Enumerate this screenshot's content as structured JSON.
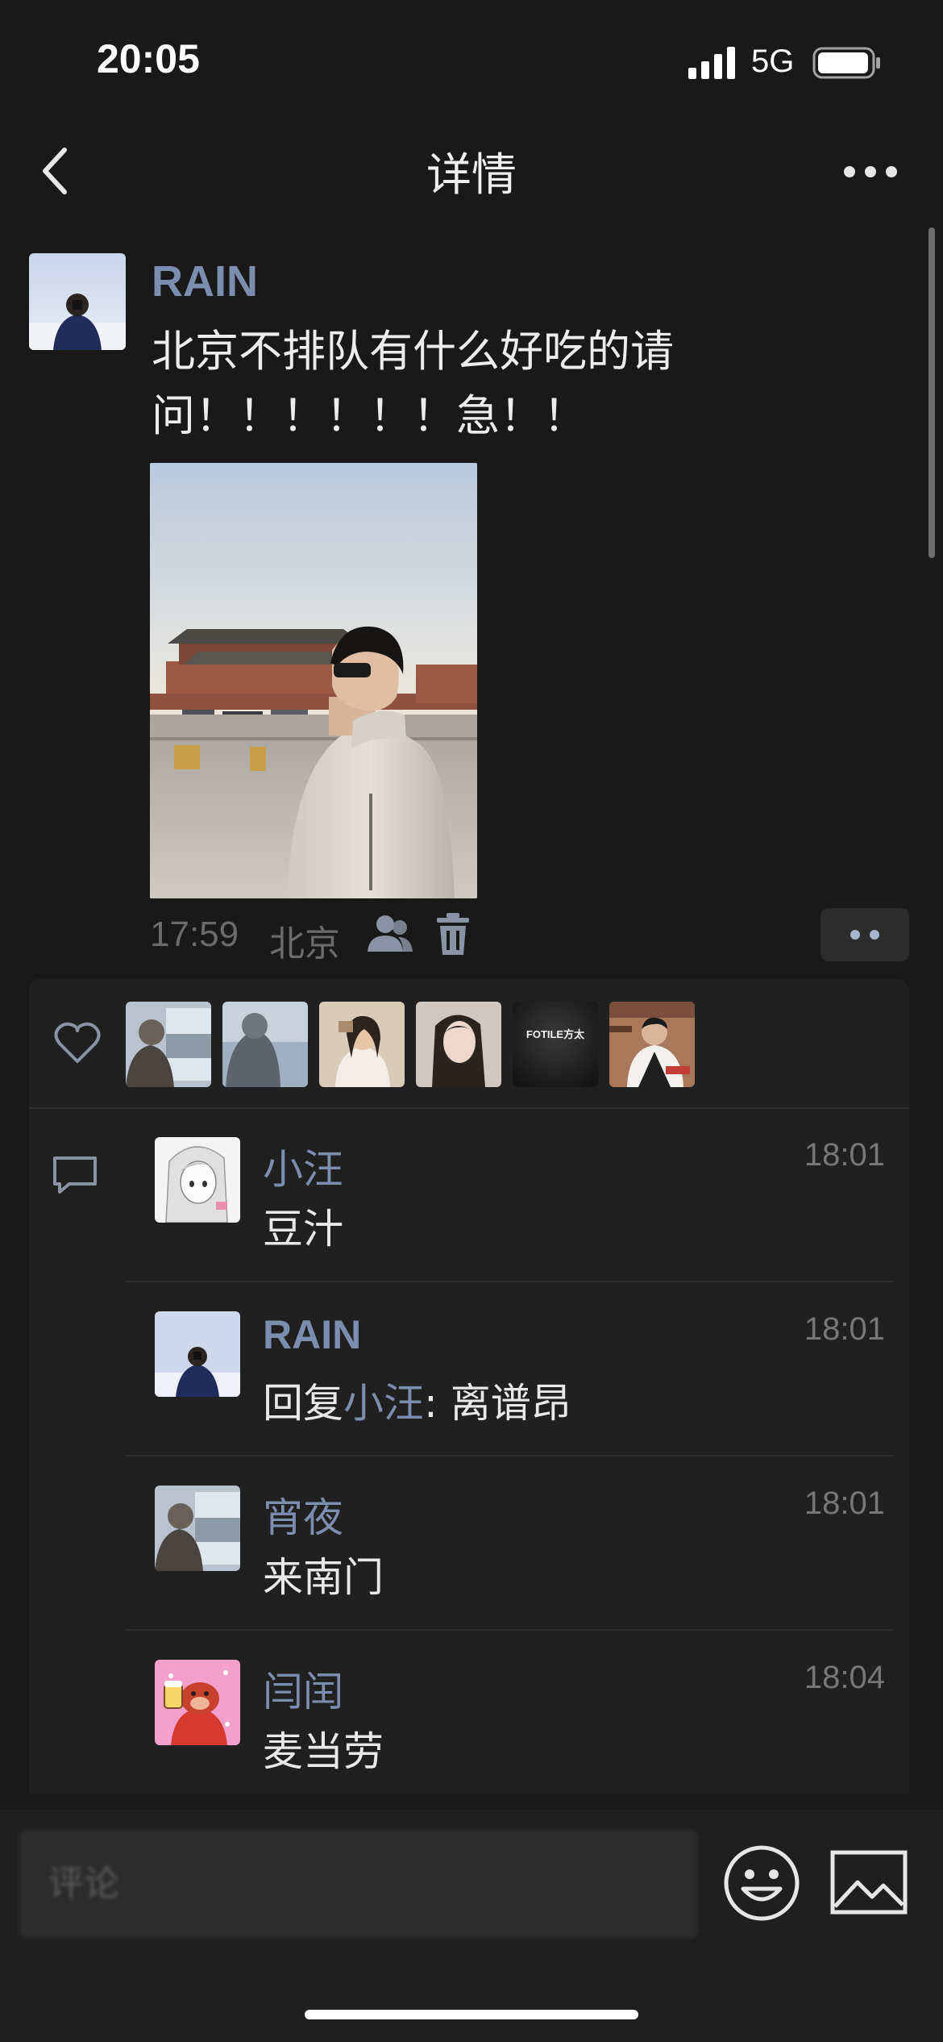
{
  "status_bar": {
    "time": "20:05",
    "network": "5G",
    "signal_icon": "signal-bars-icon",
    "battery_icon": "battery-icon"
  },
  "nav": {
    "title": "详情",
    "back_icon": "chevron-left-icon",
    "more_icon": "more-dots-icon"
  },
  "post": {
    "author": "RAIN",
    "text": "北京不排队有什么好吃的请问！！！！！！急！！",
    "time": "17:59",
    "location": "北京",
    "visibility_icon": "contacts-icon",
    "delete_icon": "trash-icon",
    "action_icon": "two-dots-icon"
  },
  "likes": {
    "icon": "heart-icon",
    "avatars": [
      "like-avatar-1",
      "like-avatar-2",
      "like-avatar-3",
      "like-avatar-4",
      "like-avatar-fotile",
      "like-avatar-6"
    ],
    "fotile_label": "FOTILE方太"
  },
  "comments": {
    "icon": "comment-icon",
    "items": [
      {
        "name": "小汪",
        "text": "豆汁",
        "time": "18:01"
      },
      {
        "name": "RAIN",
        "reply_prefix": "回复",
        "reply_to": "小汪",
        "reply_sep": ": ",
        "text": "离谱昂",
        "time": "18:01"
      },
      {
        "name": "宵夜",
        "text": "来南门",
        "time": "18:01"
      },
      {
        "name": "闫闰",
        "text": "麦当劳",
        "time": "18:04"
      }
    ]
  },
  "input": {
    "placeholder": "评论",
    "emoji_icon": "emoji-icon",
    "image_icon": "image-icon"
  },
  "colors": {
    "background": "#191919",
    "panel": "#202020",
    "name_blue": "#7b8eb0",
    "muted": "#6b6b6b"
  }
}
